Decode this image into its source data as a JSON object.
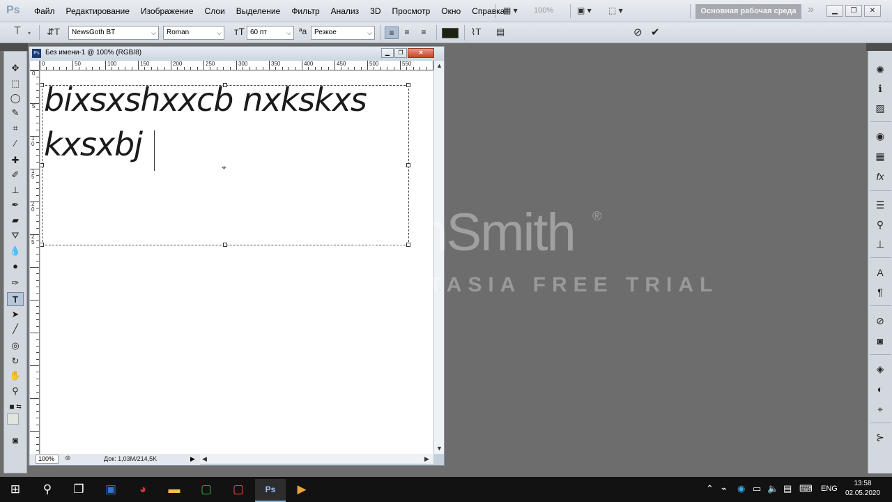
{
  "menubar": {
    "logo": "Ps",
    "items": [
      "Файл",
      "Редактирование",
      "Изображение",
      "Слои",
      "Выделение",
      "Фильтр",
      "Анализ",
      "3D",
      "Просмотр",
      "Окно",
      "Справка"
    ],
    "zoom": "100%",
    "workspace": "Основная рабочая среда"
  },
  "options": {
    "font_family": "NewsGoth BT",
    "font_style": "Roman",
    "font_size": "60 пт",
    "antialias": "Резкое",
    "text_color": "#1b2211"
  },
  "document": {
    "title": "Без имени-1 @ 100% (RGB/8)",
    "text_lines": [
      "bixsxshxxcb nxkskxs",
      "kxsxbj"
    ],
    "zoom": "100%",
    "doc_info": "Док: 1,03M/214,5K",
    "ruler_h_labels": [
      "0",
      "50",
      "100",
      "150",
      "200",
      "250",
      "300",
      "350",
      "400",
      "450",
      "500",
      "550"
    ],
    "ruler_v_labels": [
      "0",
      "5",
      "1 0",
      "1 5",
      "2 0",
      "2 5"
    ]
  },
  "watermark": {
    "brand": "TechSmith",
    "registered": "®",
    "trial": "MADE WITH CAMTASIA FREE TRIAL"
  },
  "taskbar": {
    "lang": "ENG",
    "time": "13:58",
    "date": "02.05.2020"
  },
  "colors": {
    "accent": "#76b9ed",
    "foreground_swatch": "#1b2211"
  }
}
